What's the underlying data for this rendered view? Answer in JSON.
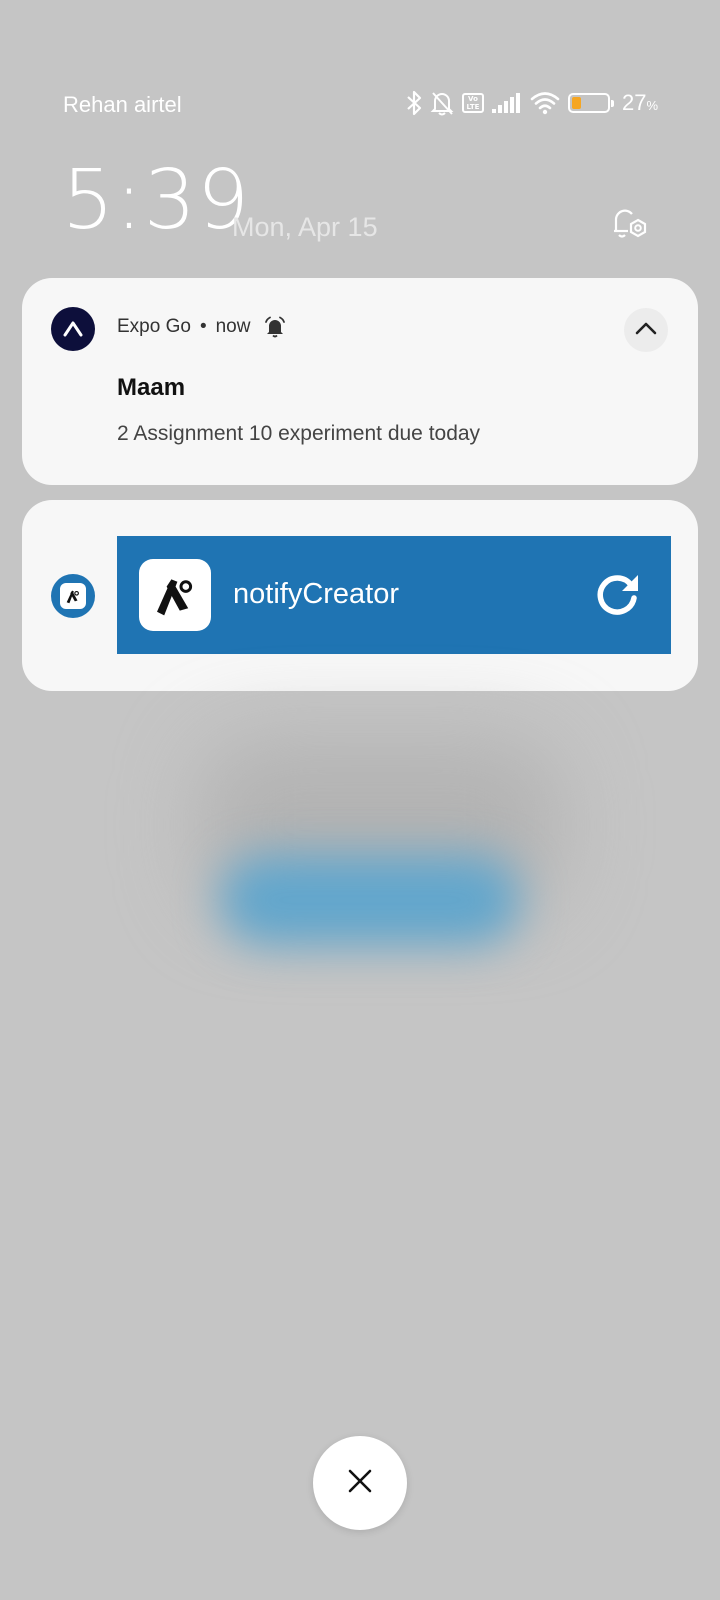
{
  "status_bar": {
    "carrier": "Rehan airtel",
    "volte_label": "Vo LTE",
    "battery_value": "27",
    "battery_unit": "%",
    "battery_level": 0.27,
    "icons": [
      "bluetooth-icon",
      "bell-off-icon",
      "volte-icon",
      "signal-icon",
      "wifi-icon",
      "battery-icon"
    ]
  },
  "lockscreen": {
    "time": "5:39",
    "date": "Mon, Apr 15",
    "settings_icon": "bell-settings-icon"
  },
  "notification": {
    "app_name": "Expo Go",
    "separator": "•",
    "timestamp": "now",
    "title": "Maam",
    "body": "2 Assignment 10 experiment due today",
    "icons": [
      "expo-logo-icon",
      "alarm-bell-icon",
      "chevron-up-icon"
    ]
  },
  "dev_notification": {
    "project_name": "notifyCreator",
    "accent": "#1f74b3",
    "icons": [
      "expo-app-icon",
      "reload-icon"
    ]
  },
  "controls": {
    "close_icon": "close-icon"
  }
}
